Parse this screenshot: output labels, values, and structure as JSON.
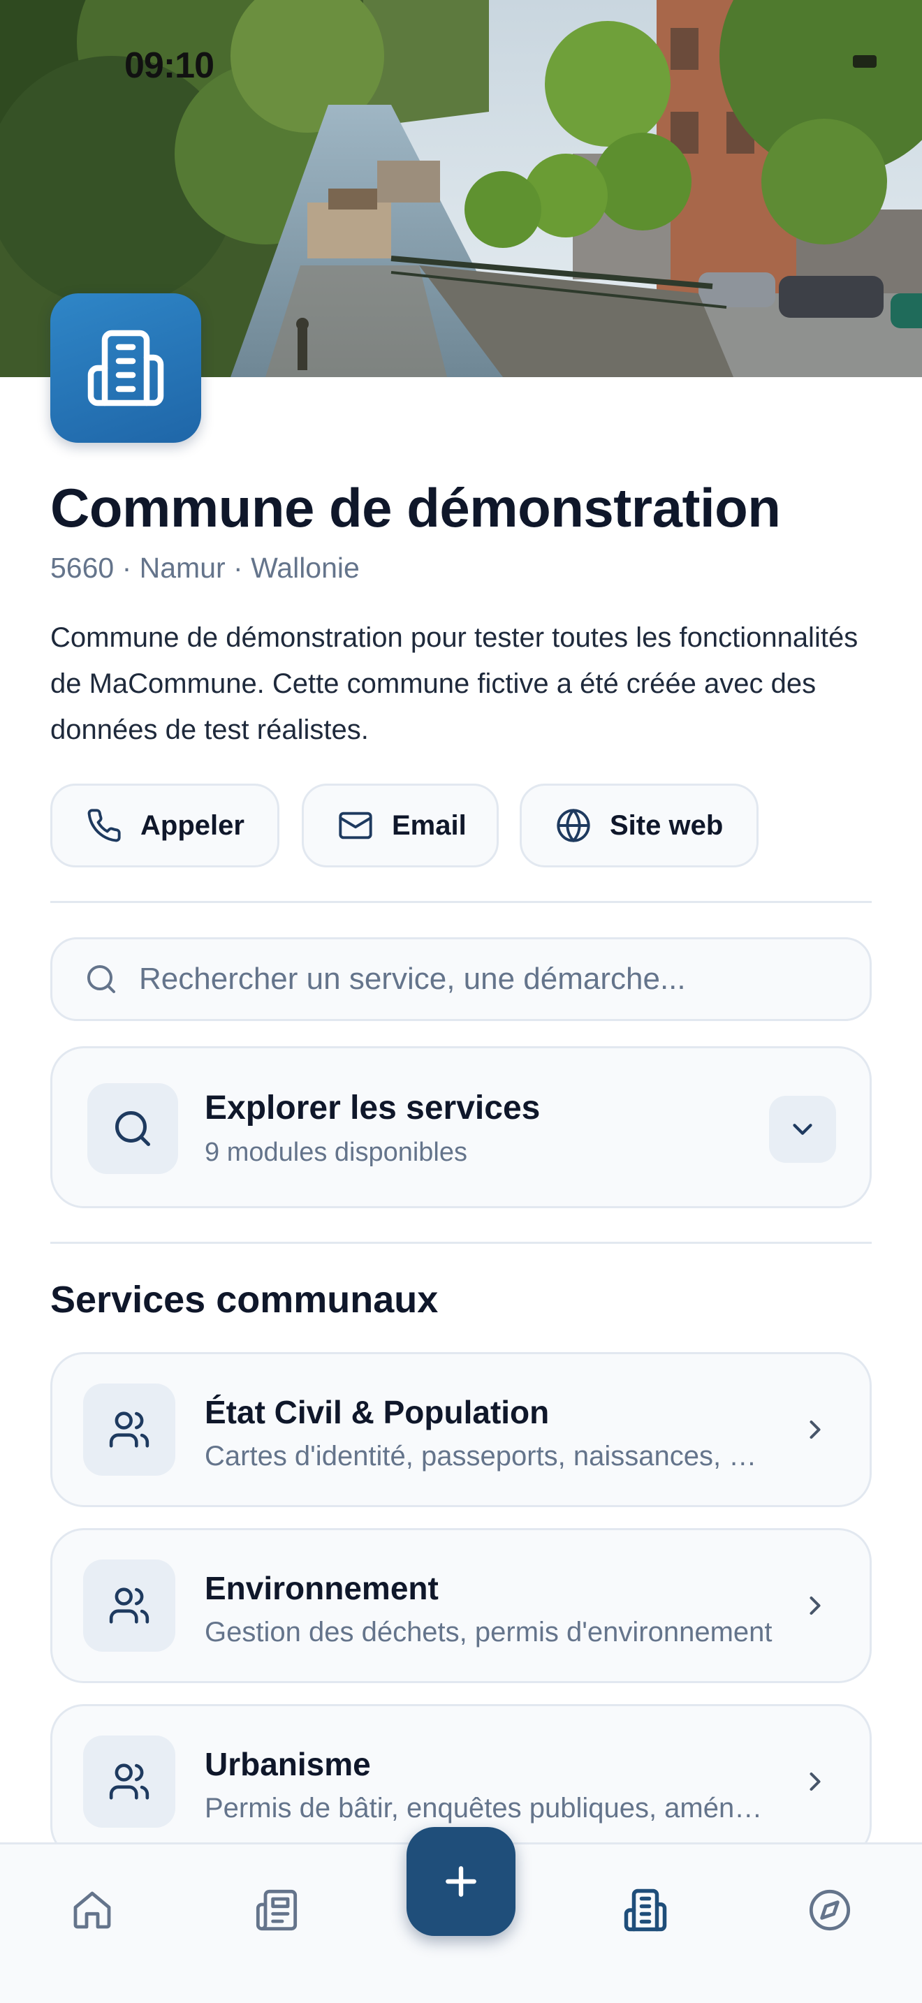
{
  "status_bar": {
    "time": "09:10"
  },
  "hero": {
    "image": "river-town-photo"
  },
  "logo": {
    "icon": "building-icon",
    "color": "#2a7bbd"
  },
  "commune": {
    "name": "Commune de démonstration",
    "location": "5660 · Namur · Wallonie",
    "description": "Commune de démonstration pour tester toutes les fonctionnalités de MaCommune. Cette commune fictive a été créée avec des données de test réalistes."
  },
  "contact": {
    "call_label": "Appeler",
    "email_label": "Email",
    "website_label": "Site web"
  },
  "search": {
    "placeholder": "Rechercher un service, une démarche...",
    "value": ""
  },
  "explore": {
    "title": "Explorer les services",
    "subtitle": "9 modules disponibles"
  },
  "services_section": {
    "title": "Services communaux",
    "items": [
      {
        "title": "État Civil & Population",
        "subtitle": "Cartes d'identité, passeports, naissances, mariages",
        "icon": "users-icon"
      },
      {
        "title": "Environnement",
        "subtitle": "Gestion des déchets, permis d'environnement",
        "icon": "users-icon"
      },
      {
        "title": "Urbanisme",
        "subtitle": "Permis de bâtir, enquêtes publiques, aménagement",
        "icon": "users-icon"
      }
    ]
  },
  "bottom_nav": {
    "items": [
      "home-icon",
      "news-icon",
      "add-icon",
      "building-icon",
      "compass-icon"
    ],
    "active": "building-icon",
    "active_color": "#1f4e7a",
    "inactive_color": "#64748b"
  }
}
